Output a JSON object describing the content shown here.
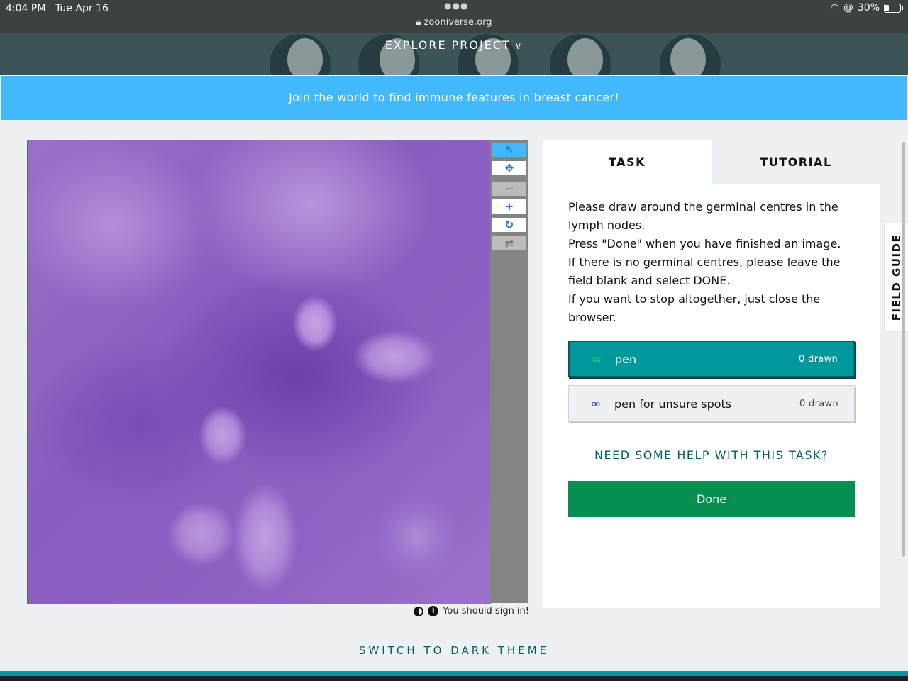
{
  "status_bar": {
    "time": "4:04 PM",
    "date": "Tue Apr 16",
    "url": "zooniverse.org",
    "battery": "30%"
  },
  "header": {
    "nav_label": "EXPLORE PROJECT"
  },
  "announcement": "Join the world to find immune features in breast cancer!",
  "subject_viewer": {
    "footnote": "You should sign in!",
    "toolbar": [
      "select-icon",
      "move-icon",
      "zoom-out-icon",
      "zoom-in-icon",
      "rotate-icon",
      "reset-icon"
    ]
  },
  "task_panel": {
    "tabs": [
      {
        "label": "TASK",
        "active": true
      },
      {
        "label": "TUTORIAL",
        "active": false
      }
    ],
    "instructions": [
      "Please draw around the germinal centres in the lymph nodes.",
      "Press \"Done\" when you have finished an image.",
      "If there is no germinal centres, please leave the field blank and select DONE.",
      "If you want to stop altogether, just close the browser."
    ],
    "tools": [
      {
        "label": "pen",
        "count": "0 drawn",
        "selected": true,
        "color": "#2fd95f"
      },
      {
        "label": "pen for unsure spots",
        "count": "0 drawn",
        "selected": false,
        "color": "#2a35d6"
      }
    ],
    "help_link": "NEED SOME HELP WITH THIS TASK?",
    "done_label": "Done"
  },
  "field_guide_label": "FIELD GUIDE",
  "dark_theme_link": "SWITCH TO DARK THEME",
  "colors": {
    "accent": "#00979d",
    "announcement": "#43b9fb",
    "done": "#078f52"
  }
}
